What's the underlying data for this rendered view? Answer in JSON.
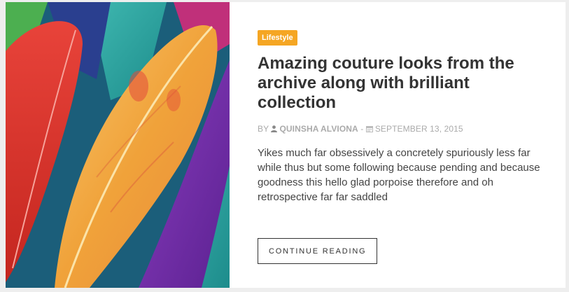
{
  "post": {
    "category": "Lifestyle",
    "title": "Amazing couture looks from the archive along with brilliant collection",
    "meta": {
      "by": "BY",
      "author": "QUINSHA ALVIONA",
      "separator": "-",
      "date": "SEPTEMBER 13, 2015"
    },
    "excerpt": "Yikes much far obsessively a concretely spuriously less far while thus but some following because pending and because goodness this hello glad porpoise therefore and oh retrospective far far saddled",
    "cta_label": "CONTINUE READING",
    "image_subject": "colorful feathers"
  },
  "colors": {
    "badge": "#f5a623",
    "title": "#333333",
    "meta": "#aaaaaa",
    "text": "#444444"
  },
  "icons": {
    "author": "user-icon",
    "date": "calendar-icon"
  }
}
